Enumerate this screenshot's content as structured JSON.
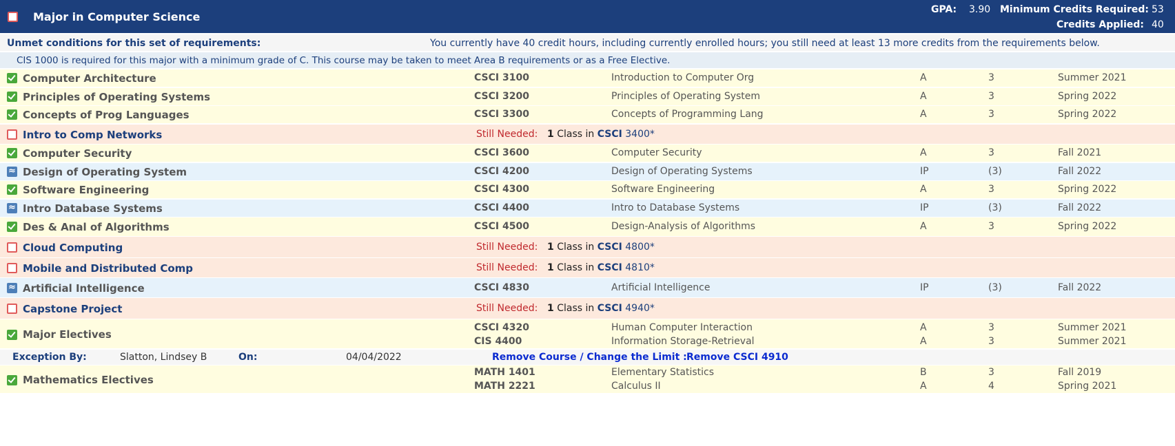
{
  "header": {
    "title": "Major in Computer Science",
    "gpa_label": "GPA:",
    "gpa_value": "3.90",
    "min_credits_label": "Minimum Credits Required:",
    "min_credits_value": "53",
    "credits_applied_label": "Credits Applied:",
    "credits_applied_value": "40"
  },
  "unmet": {
    "label": "Unmet conditions for this set of requirements:",
    "message": "You currently have 40 credit hours, including currently enrolled hours; you still need at least 13 more credits from the requirements below."
  },
  "note": "CIS 1000 is required for this major with a minimum grade of C. This course may be taken to meet Area B requirements or as a Free Elective.",
  "still_needed_label": "Still Needed:",
  "requirements": [
    {
      "name": "Computer Architecture",
      "status": "complete",
      "course": "CSCI 3100",
      "title": "Introduction to Computer Org",
      "grade": "A",
      "credits": "3",
      "term": "Summer 2021"
    },
    {
      "name": "Principles of Operating Systems",
      "status": "complete",
      "course": "CSCI 3200",
      "title": "Principles of Operating System",
      "grade": "A",
      "credits": "3",
      "term": "Spring 2022"
    },
    {
      "name": "Concepts of Prog Languages",
      "status": "complete",
      "course": "CSCI 3300",
      "title": "Concepts of Programming Lang",
      "grade": "A",
      "credits": "3",
      "term": "Spring 2022"
    },
    {
      "name": "Intro to Comp Networks",
      "status": "needed",
      "count": "1",
      "mid": "Class in",
      "subject": "CSCI",
      "number": "3400*"
    },
    {
      "name": "Computer Security",
      "status": "complete",
      "course": "CSCI 3600",
      "title": "Computer Security",
      "grade": "A",
      "credits": "3",
      "term": "Fall 2021"
    },
    {
      "name": "Design of Operating System",
      "status": "inprogress",
      "course": "CSCI 4200",
      "title": "Design of Operating Systems",
      "grade": "IP",
      "credits": "(3)",
      "term": "Fall 2022"
    },
    {
      "name": "Software Engineering",
      "status": "complete",
      "course": "CSCI 4300",
      "title": "Software Engineering",
      "grade": "A",
      "credits": "3",
      "term": "Spring 2022"
    },
    {
      "name": "Intro Database Systems",
      "status": "inprogress",
      "course": "CSCI 4400",
      "title": "Intro to Database Systems",
      "grade": "IP",
      "credits": "(3)",
      "term": "Fall 2022"
    },
    {
      "name": "Des & Anal of Algorithms",
      "status": "complete",
      "course": "CSCI 4500",
      "title": "Design-Analysis of Algorithms",
      "grade": "A",
      "credits": "3",
      "term": "Spring 2022"
    },
    {
      "name": "Cloud Computing",
      "status": "needed",
      "count": "1",
      "mid": "Class in",
      "subject": "CSCI",
      "number": "4800*"
    },
    {
      "name": "Mobile and Distributed Comp",
      "status": "needed",
      "count": "1",
      "mid": "Class in",
      "subject": "CSCI",
      "number": "4810*"
    },
    {
      "name": "Artificial Intelligence",
      "status": "inprogress",
      "course": "CSCI 4830",
      "title": "Artificial Intelligence",
      "grade": "IP",
      "credits": "(3)",
      "term": "Fall 2022"
    },
    {
      "name": "Capstone Project",
      "status": "needed",
      "count": "1",
      "mid": "Class in",
      "subject": "CSCI",
      "number": "4940*"
    }
  ],
  "major_electives": {
    "name": "Major Electives",
    "courses": [
      {
        "course": "CSCI 4320",
        "title": "Human Computer Interaction",
        "grade": "A",
        "credits": "3",
        "term": "Summer 2021"
      },
      {
        "course": "CIS 4400",
        "title": "Information Storage-Retrieval",
        "grade": "A",
        "credits": "3",
        "term": "Summer 2021"
      }
    ]
  },
  "exception": {
    "by_label": "Exception By:",
    "by_value": "Slatton, Lindsey B",
    "on_label": "On:",
    "on_value": "04/04/2022",
    "action": "Remove Course / Change the Limit :",
    "action_detail": "Remove CSCI 4910"
  },
  "math_electives": {
    "name": "Mathematics Electives",
    "courses": [
      {
        "course": "MATH 1401",
        "title": "Elementary Statistics",
        "grade": "B",
        "credits": "3",
        "term": "Fall 2019"
      },
      {
        "course": "MATH 2221",
        "title": "Calculus II",
        "grade": "A",
        "credits": "4",
        "term": "Spring 2021"
      }
    ]
  }
}
